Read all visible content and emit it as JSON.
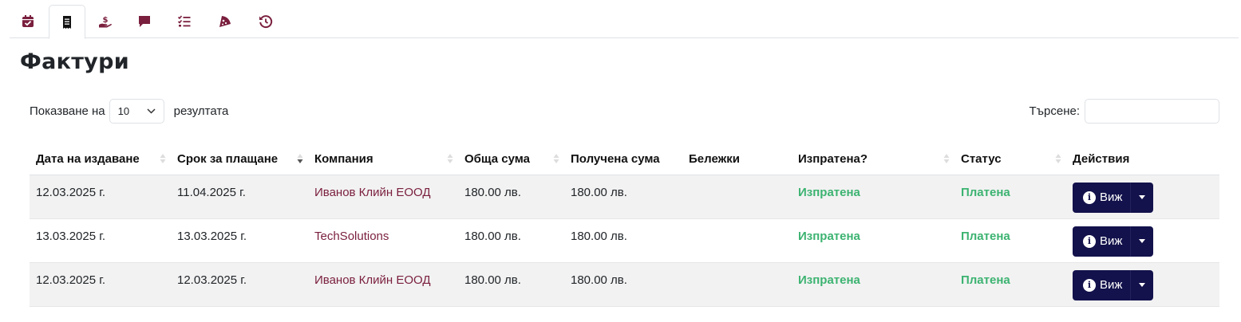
{
  "tabs": [
    {
      "name": "calendar-check-icon",
      "active": false
    },
    {
      "name": "receipt-icon",
      "active": true
    },
    {
      "name": "hand-holding-dollar-icon",
      "active": false
    },
    {
      "name": "comment-icon",
      "active": false
    },
    {
      "name": "list-check-icon",
      "active": false
    },
    {
      "name": "pizza-slice-icon",
      "active": false
    },
    {
      "name": "history-icon",
      "active": false
    }
  ],
  "page": {
    "title": "Фактури"
  },
  "length": {
    "prefix": "Показване на",
    "value": "10",
    "suffix": "резултата"
  },
  "search": {
    "label": "Търсене:",
    "placeholder": ""
  },
  "table": {
    "headers": [
      "Дата на издаване",
      "Срок за плащане",
      "Компания",
      "Обща сума",
      "Получена сума",
      "Бележки",
      "Изпратена?",
      "Статус",
      "Действия"
    ],
    "rows": [
      {
        "issued": "12.03.2025 г.",
        "due": "11.04.2025 г.",
        "company": "Иванов Клийн ЕООД",
        "total": "180.00 лв.",
        "received": "180.00 лв.",
        "notes": "",
        "sent": "Изпратена",
        "status": "Платена",
        "action": "Виж"
      },
      {
        "issued": "13.03.2025 г.",
        "due": "13.03.2025 г.",
        "company": "TechSolutions",
        "total": "180.00 лв.",
        "received": "180.00 лв.",
        "notes": "",
        "sent": "Изпратена",
        "status": "Платена",
        "action": "Виж"
      },
      {
        "issued": "12.03.2025 г.",
        "due": "12.03.2025 г.",
        "company": "Иванов Клийн ЕООД",
        "total": "180.00 лв.",
        "received": "180.00 лв.",
        "notes": "",
        "sent": "Изпратена",
        "status": "Платена",
        "action": "Виж"
      }
    ]
  },
  "colors": {
    "brand": "#7a1f3d",
    "button": "#13124c",
    "success": "#3cb371"
  }
}
